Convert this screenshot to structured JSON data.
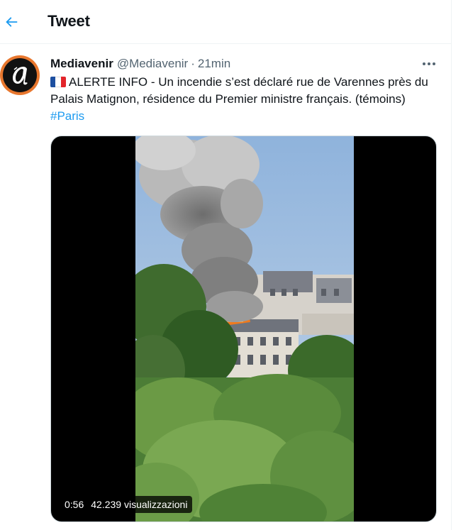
{
  "header": {
    "title": "Tweet",
    "back_icon": "arrow-left-icon"
  },
  "tweet": {
    "display_name": "Mediavenir",
    "handle": "@Mediavenir",
    "separator": "·",
    "time": "21min",
    "text_main": "ALERTE INFO - Un incendie s’est déclaré rue de Varennes près du Palais Matignon, résidence du Premier ministre français. (témoins) ",
    "hashtag": "#Paris",
    "flag_icon": "france-flag-icon"
  },
  "video": {
    "duration": "0:56",
    "views": "42.239 visualizzazioni"
  },
  "colors": {
    "accent": "#1d9bf0",
    "text": "#0f1419",
    "muted": "#536471",
    "avatar_ring": "#e8772e"
  }
}
